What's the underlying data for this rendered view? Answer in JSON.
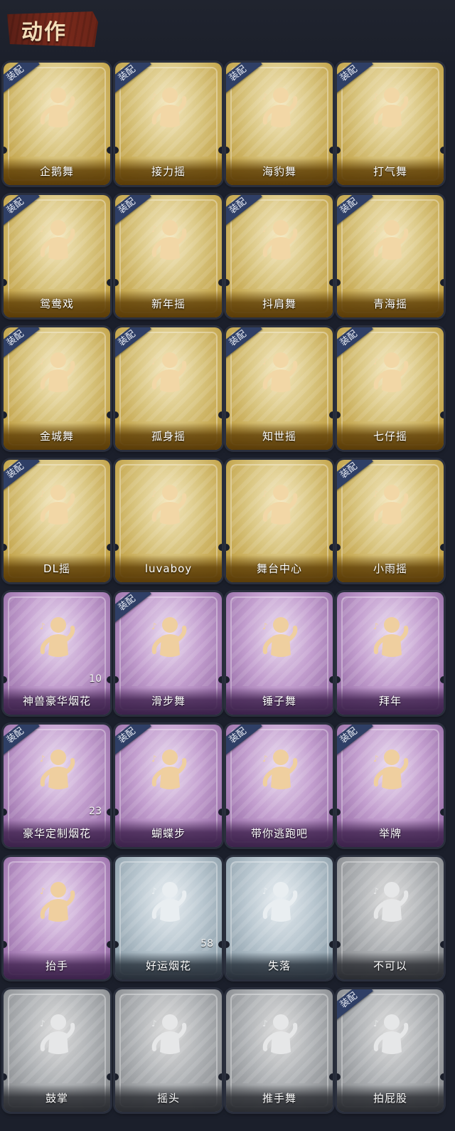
{
  "header": {
    "title": "动作"
  },
  "equipped_badge": "装配",
  "cards": [
    {
      "label": "企鹅舞",
      "tier": "gold",
      "equipped": true
    },
    {
      "label": "接力摇",
      "tier": "gold",
      "equipped": true
    },
    {
      "label": "海豹舞",
      "tier": "gold",
      "equipped": true
    },
    {
      "label": "打气舞",
      "tier": "gold",
      "equipped": true
    },
    {
      "label": "鸳鸯戏",
      "tier": "gold",
      "equipped": true
    },
    {
      "label": "新年摇",
      "tier": "gold",
      "equipped": true
    },
    {
      "label": "抖肩舞",
      "tier": "gold",
      "equipped": true
    },
    {
      "label": "青海摇",
      "tier": "gold",
      "equipped": true
    },
    {
      "label": "金城舞",
      "tier": "gold",
      "equipped": true
    },
    {
      "label": "孤身摇",
      "tier": "gold",
      "equipped": true
    },
    {
      "label": "知世摇",
      "tier": "gold",
      "equipped": true
    },
    {
      "label": "七仔摇",
      "tier": "gold",
      "equipped": true
    },
    {
      "label": "DL摇",
      "tier": "gold",
      "equipped": true
    },
    {
      "label": "luvaboy",
      "tier": "gold",
      "equipped": false
    },
    {
      "label": "舞台中心",
      "tier": "gold",
      "equipped": false
    },
    {
      "label": "小雨摇",
      "tier": "gold",
      "equipped": true
    },
    {
      "label": "神兽豪华烟花",
      "tier": "purple",
      "equipped": false,
      "count": "10"
    },
    {
      "label": "滑步舞",
      "tier": "purple",
      "equipped": true
    },
    {
      "label": "锤子舞",
      "tier": "purple",
      "equipped": false
    },
    {
      "label": "拜年",
      "tier": "purple",
      "equipped": false
    },
    {
      "label": "豪华定制烟花",
      "tier": "purple",
      "equipped": true,
      "count": "23"
    },
    {
      "label": "蝴蝶步",
      "tier": "purple",
      "equipped": true
    },
    {
      "label": "带你逃跑吧",
      "tier": "purple",
      "equipped": true
    },
    {
      "label": "举牌",
      "tier": "purple",
      "equipped": true
    },
    {
      "label": "抬手",
      "tier": "purple",
      "equipped": false
    },
    {
      "label": "好运烟花",
      "tier": "silver",
      "equipped": false,
      "count": "58"
    },
    {
      "label": "失落",
      "tier": "silver",
      "equipped": false
    },
    {
      "label": "不可以",
      "tier": "grey",
      "equipped": false
    },
    {
      "label": "鼓掌",
      "tier": "grey",
      "equipped": false
    },
    {
      "label": "摇头",
      "tier": "grey",
      "equipped": false
    },
    {
      "label": "推手舞",
      "tier": "grey",
      "equipped": false
    },
    {
      "label": "拍屁股",
      "tier": "grey",
      "equipped": true
    }
  ]
}
